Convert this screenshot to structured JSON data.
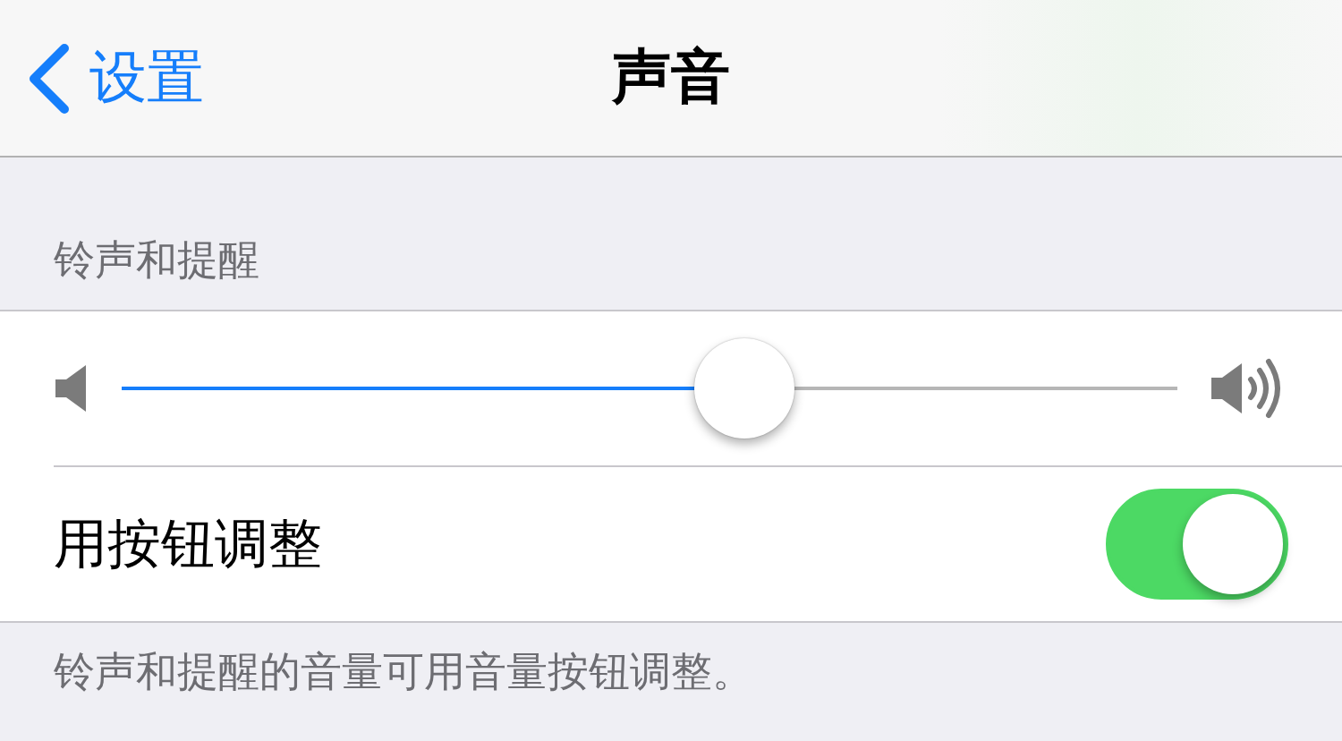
{
  "nav": {
    "back_label": "设置",
    "title": "声音"
  },
  "section": {
    "header": "铃声和提醒",
    "volume": {
      "level": 0.59
    },
    "toggle": {
      "label": "用按钮调整",
      "on": true
    },
    "footer": "铃声和提醒的音量可用音量按钮调整。"
  }
}
